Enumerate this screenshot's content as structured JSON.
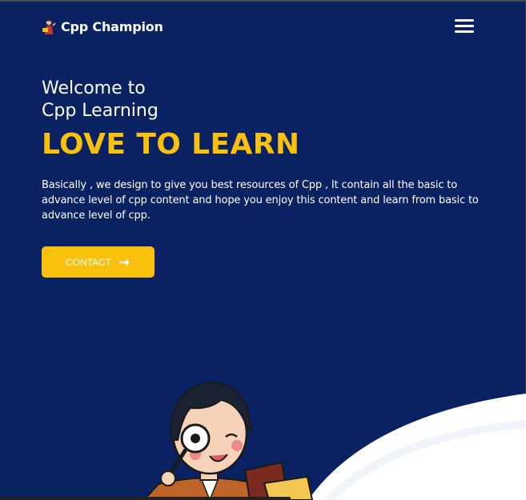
{
  "header": {
    "brand_name": "Cpp Champion",
    "brand_icon": "teacher-icon",
    "menu_icon": "hamburger-menu-icon"
  },
  "hero": {
    "welcome_line1": "Welcome to",
    "welcome_line2": "Cpp Learning",
    "headline": "LOVE TO LEARN",
    "description": "Basically , we design to give you best resources of Cpp , It contain all the basic to advance level of cpp content and hope you enjoy this content and learn from basic to advance level of cpp.",
    "cta_label": "CONTACT",
    "cta_icon": "arrow-right-icon"
  },
  "colors": {
    "background": "#0b2262",
    "accent": "#f9c10d",
    "text": "#ffffff"
  }
}
